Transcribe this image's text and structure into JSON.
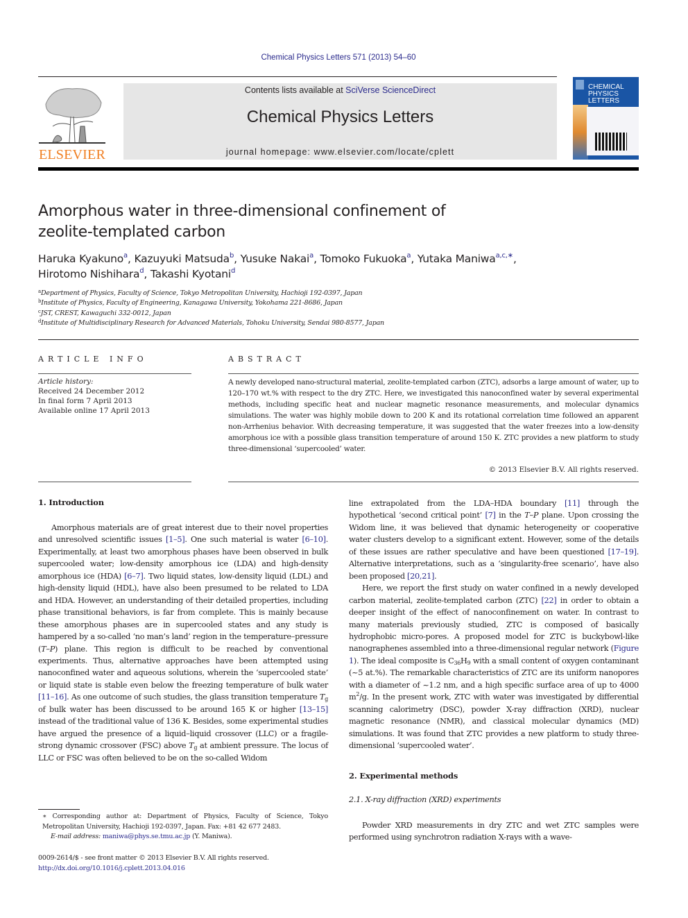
{
  "header": {
    "journal_ref": "Chemical Physics Letters 571 (2013) 54–60",
    "contents_prefix": "Contents lists available at ",
    "contents_link": "SciVerse ScienceDirect",
    "journal_title": "Chemical Physics Letters",
    "homepage": "journal homepage: www.elsevier.com/locate/cplett",
    "publisher_logo_text": "ELSEVIER",
    "cover_title_lines": [
      "CHEMICAL",
      "PHYSICS",
      "LETTERS"
    ]
  },
  "colors": {
    "link": "#2a2a8c",
    "elsevier_orange": "#f07e20",
    "masthead_bg": "#e6e6e6",
    "cover_blue": "#1a55a5"
  },
  "article": {
    "title_line1": "Amorphous water in three-dimensional confinement of",
    "title_line2": "zeolite-templated carbon",
    "authors": [
      {
        "name": "Haruka Kyakuno",
        "aff": "a",
        "sep": ", "
      },
      {
        "name": "Kazuyuki Matsuda",
        "aff": "b",
        "sep": ", "
      },
      {
        "name": "Yusuke Nakai",
        "aff": "a",
        "sep": ", "
      },
      {
        "name": "Tomoko Fukuoka",
        "aff": "a",
        "sep": ", "
      },
      {
        "name": "Yutaka Maniwa",
        "aff": "a,c,∗",
        "sep": ","
      },
      {
        "name": "Hirotomo Nishihara",
        "aff": "d",
        "sep": ", "
      },
      {
        "name": "Takashi Kyotani",
        "aff": "d",
        "sep": ""
      }
    ],
    "affiliations": [
      {
        "key": "a",
        "text": "Department of Physics, Faculty of Science, Tokyo Metropolitan University, Hachioji 192-0397, Japan"
      },
      {
        "key": "b",
        "text": "Institute of Physics, Faculty of Engineering, Kanagawa University, Yokohama 221-8686, Japan"
      },
      {
        "key": "c",
        "text": "JST, CREST, Kawaguchi 332-0012, Japan"
      },
      {
        "key": "d",
        "text": "Institute of Multidisciplinary Research for Advanced Materials, Tohoku University, Sendai 980-8577, Japan"
      }
    ]
  },
  "article_info": {
    "heading": "ARTICLE INFO",
    "history_label": "Article history:",
    "received": "Received 24 December 2012",
    "final_form": "In final form 7 April 2013",
    "online": "Available online 17 April 2013"
  },
  "abstract": {
    "heading": "ABSTRACT",
    "text": "A newly developed nano-structural material, zeolite-templated carbon (ZTC), adsorbs a large amount of water, up to 120–170 wt.% with respect to the dry ZTC. Here, we investigated this nanoconfined water by several experimental methods, including specific heat and nuclear magnetic resonance measurements, and molecular dynamics simulations. The water was highly mobile down to 200 K and its rotational correlation time followed an apparent non-Arrhenius behavior. With decreasing temperature, it was suggested that the water freezes into a low-density amorphous ice with a possible glass transition temperature of around 150 K. ZTC provides a new platform to study three-dimensional ‘supercooled’ water.",
    "copyright": "© 2013 Elsevier B.V. All rights reserved."
  },
  "body": {
    "intro_heading": "1. Introduction",
    "intro_p1": [
      {
        "t": "Amorphous materials are of great interest due to their novel properties and unresolved scientific issues "
      },
      {
        "r": "[1–5]"
      },
      {
        "t": ". One such material is water "
      },
      {
        "r": "[6–10]"
      },
      {
        "t": ". Experimentally, at least two amorphous phases have been observed in bulk supercooled water; low-density amorphous ice (LDA) and high-density amorphous ice (HDA) "
      },
      {
        "r": "[6–7]"
      },
      {
        "t": ". Two liquid states, low-density liquid (LDL) and high-density liquid (HDL), have also been presumed to be related to LDA and HDA. However, an understanding of their detailed properties, including phase transitional behaviors, is far from complete. This is mainly because these amorphous phases are in supercooled states and any study is hampered by a so-called ‘no man’s land’ region in the temperature–pressure ("
      },
      {
        "i": "T–P"
      },
      {
        "t": ") plane. This region is difficult to be reached by conventional experiments. Thus, alternative approaches have been attempted using nanoconfined water and aqueous solutions, wherein the ‘supercooled state’ or liquid state is stable even below the freezing temperature of bulk water "
      },
      {
        "r": "[11–16]"
      },
      {
        "t": ". As one outcome of such studies, the glass transition temperature "
      },
      {
        "i": "T",
        "sub": "g"
      },
      {
        "t": " of bulk water has been discussed to be around 165 K or higher "
      },
      {
        "r": "[13–15]"
      },
      {
        "t": " instead of the traditional value of 136 K. Besides, some experimental studies have argued the presence of a liquid–liquid crossover (LLC) or a fragile-strong dynamic crossover (FSC) above "
      },
      {
        "i": "T",
        "sub": "g"
      },
      {
        "t": " at ambient pressure. The locus of LLC or FSC was often believed to be on the so-called Widom "
      }
    ],
    "right_p1": [
      {
        "t": "line extrapolated from the LDA–HDA boundary "
      },
      {
        "r": "[11]"
      },
      {
        "t": " through the hypothetical ‘second critical point’ "
      },
      {
        "r": "[7]"
      },
      {
        "t": " in the "
      },
      {
        "i": "T–P"
      },
      {
        "t": " plane. Upon crossing the Widom line, it was believed that dynamic heterogeneity or cooperative water clusters develop to a significant extent. However, some of the details of these issues are rather speculative and have been questioned "
      },
      {
        "r": "[17–19]"
      },
      {
        "t": ". Alternative interpretations, such as a ‘singularity-free scenario’, have also been proposed "
      },
      {
        "r": "[20,21]"
      },
      {
        "t": "."
      }
    ],
    "right_p2": [
      {
        "t": "Here, we report the first study on water confined in a newly developed carbon material, zeolite-templated carbon (ZTC) "
      },
      {
        "r": "[22]"
      },
      {
        "t": " in order to obtain a deeper insight of the effect of nanoconfinement on water. In contrast to many materials previously studied, ZTC is composed of basically hydrophobic micro-pores. A proposed model for ZTC is buckybowl-like nanographenes assembled into a three-dimensional regular network ("
      },
      {
        "r": "Figure 1"
      },
      {
        "t": "). The ideal composite is C"
      },
      {
        "s": "36"
      },
      {
        "t": "H"
      },
      {
        "s": "9"
      },
      {
        "t": " with a small content of oxygen contaminant (~5 at.%). The remarkable characteristics of ZTC are its uniform nanopores with a diameter of ~1.2 nm, and a high specific surface area of up to 4000 m"
      },
      {
        "u": "2"
      },
      {
        "t": "/g. In the present work, ZTC with water was investigated by differential scanning calorimetry (DSC), powder X-ray diffraction (XRD), nuclear magnetic resonance (NMR), and classical molecular dynamics (MD) simulations. It was found that ZTC provides a new platform to study three-dimensional ‘supercooled water’."
      }
    ],
    "exp_heading": "2. Experimental methods",
    "xrd_subheading": "2.1. X-ray diffraction (XRD) experiments",
    "xrd_p1": "Powder XRD measurements in dry ZTC and wet ZTC samples were performed using synchrotron radiation X-rays with a wave-"
  },
  "footnotes": {
    "corresponding": "∗ Corresponding author at: Department of Physics, Faculty of Science, Tokyo Metropolitan University, Hachioji 192-0397, Japan. Fax: +81 42 677 2483.",
    "email_label": "E-mail address: ",
    "email": "maniwa@phys.se.tmu.ac.jp",
    "email_suffix": " (Y. Maniwa).",
    "front_matter": "0009-2614/$ - see front matter © 2013 Elsevier B.V. All rights reserved.",
    "doi": "http://dx.doi.org/10.1016/j.cplett.2013.04.016"
  }
}
